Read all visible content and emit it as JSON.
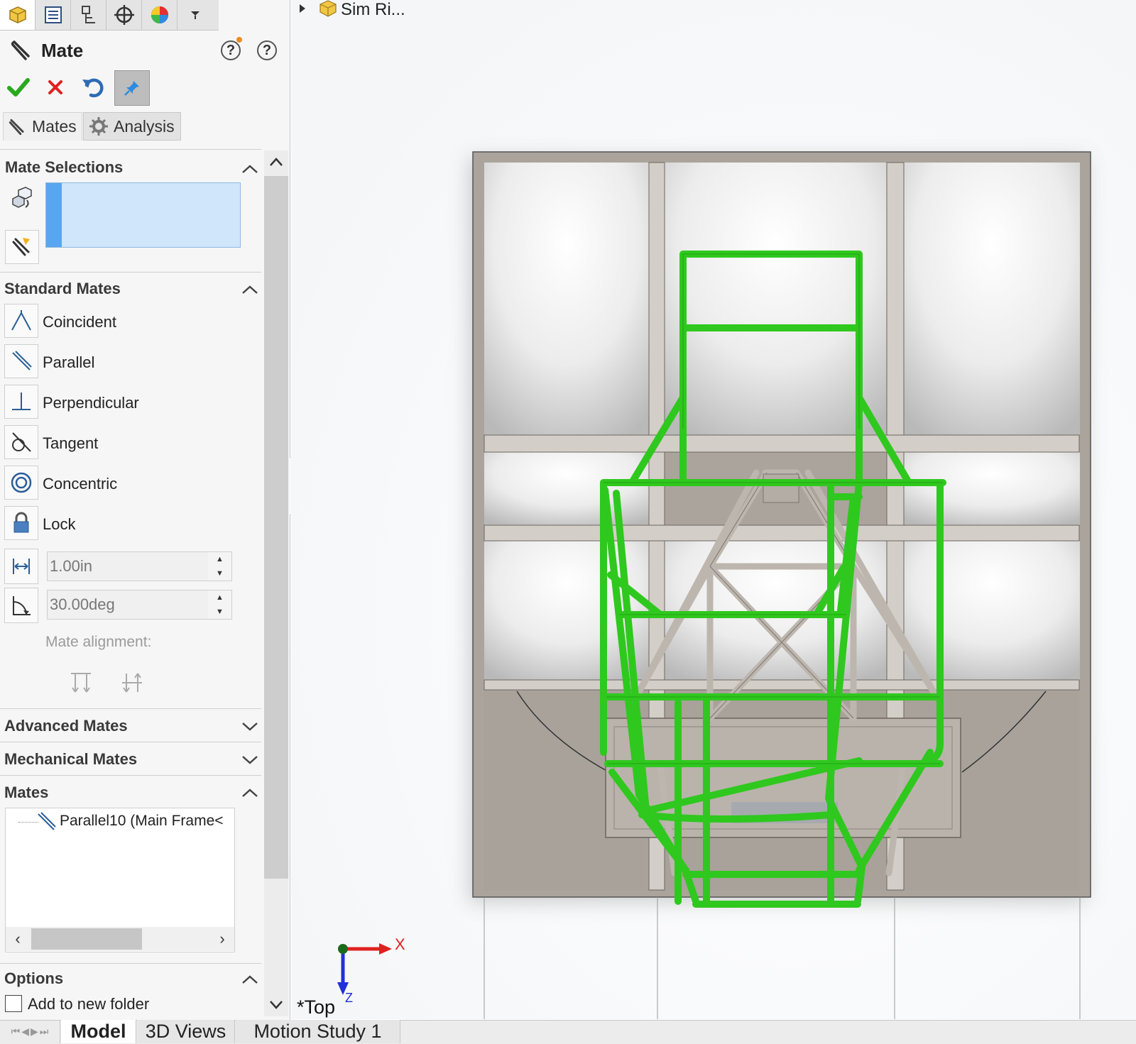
{
  "manager_tabs": [
    {
      "name": "featuremanager-tab-icon"
    },
    {
      "name": "propertymanager-tab-icon"
    },
    {
      "name": "configurationmanager-tab-icon"
    },
    {
      "name": "dimxpert-tab-icon"
    },
    {
      "name": "display-manager-tab-icon"
    },
    {
      "name": "more-tabs-icon"
    }
  ],
  "pm": {
    "title": "Mate",
    "help_whats_new": "?",
    "help": "?"
  },
  "subtabs": {
    "mates": "Mates",
    "analysis": "Analysis"
  },
  "groups": {
    "mate_selections": "Mate Selections",
    "standard_mates": "Standard Mates",
    "advanced_mates": "Advanced Mates",
    "mechanical_mates": "Mechanical Mates",
    "mates": "Mates",
    "options": "Options"
  },
  "standard_mates": [
    {
      "label": "Coincident",
      "icon": "coincident-icon"
    },
    {
      "label": "Parallel",
      "icon": "parallel-icon"
    },
    {
      "label": "Perpendicular",
      "icon": "perpendicular-icon"
    },
    {
      "label": "Tangent",
      "icon": "tangent-icon"
    },
    {
      "label": "Concentric",
      "icon": "concentric-icon"
    },
    {
      "label": "Lock",
      "icon": "lock-icon"
    }
  ],
  "distance": {
    "value": "1.00in"
  },
  "angle": {
    "value": "30.00deg"
  },
  "mate_alignment_label": "Mate alignment:",
  "mates_list": {
    "item": "Parallel10 (Main Frame<"
  },
  "options": {
    "add_to_new_folder": "Add to new folder",
    "add_to_new_folder_checked": false
  },
  "bottom_tabs": {
    "model": "Model",
    "views3d": "3D Views",
    "motion": "Motion Study 1"
  },
  "viewport": {
    "tree_root": "Sim Ri...",
    "view_name": "*Top",
    "axis_x": "X",
    "axis_z": "Z"
  },
  "colors": {
    "frame_green": "#2fc81e",
    "frame_gray": "#c9c3bb",
    "selection_box": "#cfe6fb",
    "selection_accent": "#58a6ef",
    "accept": "#2aa81e",
    "cancel": "#e02020"
  }
}
